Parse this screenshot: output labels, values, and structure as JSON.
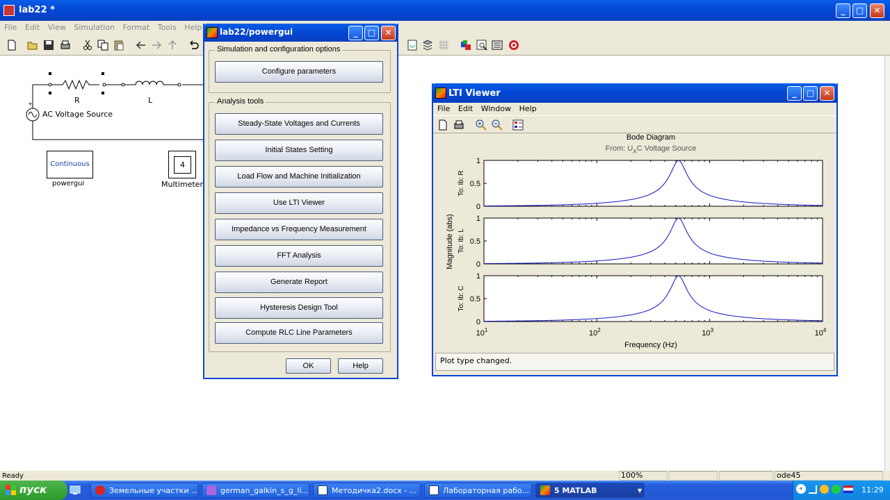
{
  "simulink": {
    "title": "lab22 *",
    "menu": [
      "File",
      "Edit",
      "View",
      "Simulation",
      "Format",
      "Tools",
      "Help"
    ],
    "blocks": {
      "resistor_label": "R",
      "inductor_label": "L",
      "source_label": "AC Voltage Source",
      "powergui_block_text": "Continuous",
      "powergui_label": "powergui",
      "multimeter_value": "4",
      "multimeter_label": "Multimeter"
    },
    "status": {
      "left": "Ready",
      "zoom": "100%",
      "solver": "ode45"
    }
  },
  "powergui": {
    "title": "lab22/powergui",
    "group1_title": "Simulation and configuration options",
    "configure_label": "Configure parameters",
    "group2_title": "Analysis tools",
    "tools": [
      "Steady-State Voltages and Currents",
      "Initial States Setting",
      "Load Flow and Machine Initialization",
      "Use LTI Viewer",
      "Impedance vs Frequency Measurement",
      "FFT Analysis",
      "Generate Report",
      "Hysteresis Design Tool",
      "Compute RLC  Line Parameters"
    ],
    "ok_label": "OK",
    "help_label": "Help"
  },
  "lti": {
    "title": "LTI Viewer",
    "menu": [
      "File",
      "Edit",
      "Window",
      "Help"
    ],
    "plot_title": "Bode Diagram",
    "from_prefix": "From: U",
    "from_sub": "A",
    "from_suffix": "C Voltage Source",
    "ylabel": "Magnitude (abs)",
    "xlabel": "Frequency  (Hz)",
    "status": "Plot type changed."
  },
  "chart_data": {
    "type": "line",
    "title": "Bode Diagram",
    "subtitle": "From: U_AC Voltage Source",
    "xlabel": "Frequency  (Hz)",
    "ylabel": "Magnitude (abs)",
    "xscale": "log",
    "xlim": [
      10,
      10000
    ],
    "x_tick_labels": [
      "10^1",
      "10^2",
      "10^3",
      "10^4"
    ],
    "y_ticks": [
      "0",
      "0.5",
      "1"
    ],
    "ylim": [
      0,
      1
    ],
    "resonance_hz": 530,
    "series": [
      {
        "name": "To: Ib: R",
        "x": [
          10,
          50,
          100,
          200,
          300,
          400,
          480,
          530,
          580,
          700,
          1000,
          2000,
          5000,
          10000
        ],
        "values": [
          0.003,
          0.014,
          0.03,
          0.07,
          0.13,
          0.26,
          0.55,
          1.0,
          0.62,
          0.25,
          0.11,
          0.045,
          0.017,
          0.008
        ]
      },
      {
        "name": "To: Ib: L",
        "x": [
          10,
          50,
          100,
          200,
          300,
          400,
          480,
          530,
          580,
          700,
          1000,
          2000,
          5000,
          10000
        ],
        "values": [
          0.003,
          0.014,
          0.03,
          0.07,
          0.13,
          0.26,
          0.55,
          1.0,
          0.62,
          0.25,
          0.11,
          0.045,
          0.017,
          0.008
        ]
      },
      {
        "name": "To: Ib: C",
        "x": [
          10,
          50,
          100,
          200,
          300,
          400,
          480,
          530,
          580,
          700,
          1000,
          2000,
          5000,
          10000
        ],
        "values": [
          0.003,
          0.014,
          0.03,
          0.07,
          0.13,
          0.26,
          0.55,
          1.0,
          0.62,
          0.25,
          0.11,
          0.045,
          0.017,
          0.008
        ]
      }
    ]
  },
  "taskbar": {
    "start": "пуск",
    "items": [
      "Земельные участки ...",
      "german_galkin_s_g_li...",
      "Методичка2.docx - ...",
      "Лабораторная рабо...",
      "5 MATLAB"
    ],
    "clock": "11:29"
  }
}
